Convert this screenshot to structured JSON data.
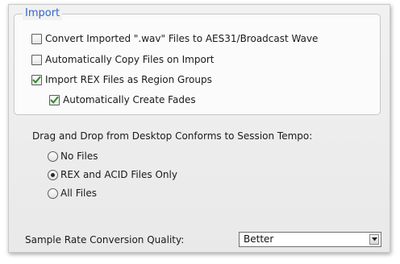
{
  "import_group": {
    "title": "Import",
    "options": [
      {
        "label": "Convert Imported \".wav\" Files to AES31/Broadcast Wave",
        "checked": false
      },
      {
        "label": "Automatically Copy Files on Import",
        "checked": false
      },
      {
        "label": "Import REX Files as Region Groups",
        "checked": true
      },
      {
        "label": "Automatically Create Fades",
        "checked": true
      }
    ]
  },
  "drag_drop": {
    "label": "Drag and Drop from Desktop Conforms to Session Tempo:",
    "options": [
      {
        "label": "No Files",
        "selected": false
      },
      {
        "label": "REX and ACID Files Only",
        "selected": true
      },
      {
        "label": "All Files",
        "selected": false
      }
    ]
  },
  "sample_rate": {
    "label": "Sample Rate Conversion Quality:",
    "value": "Better"
  },
  "icons": {
    "checkmark": "checkmark-icon",
    "radio_dot": "radio-dot-icon",
    "dropdown": "chevron-down-icon"
  },
  "colors": {
    "group_title": "#3366cc",
    "checkmark": "#2d8a22"
  }
}
